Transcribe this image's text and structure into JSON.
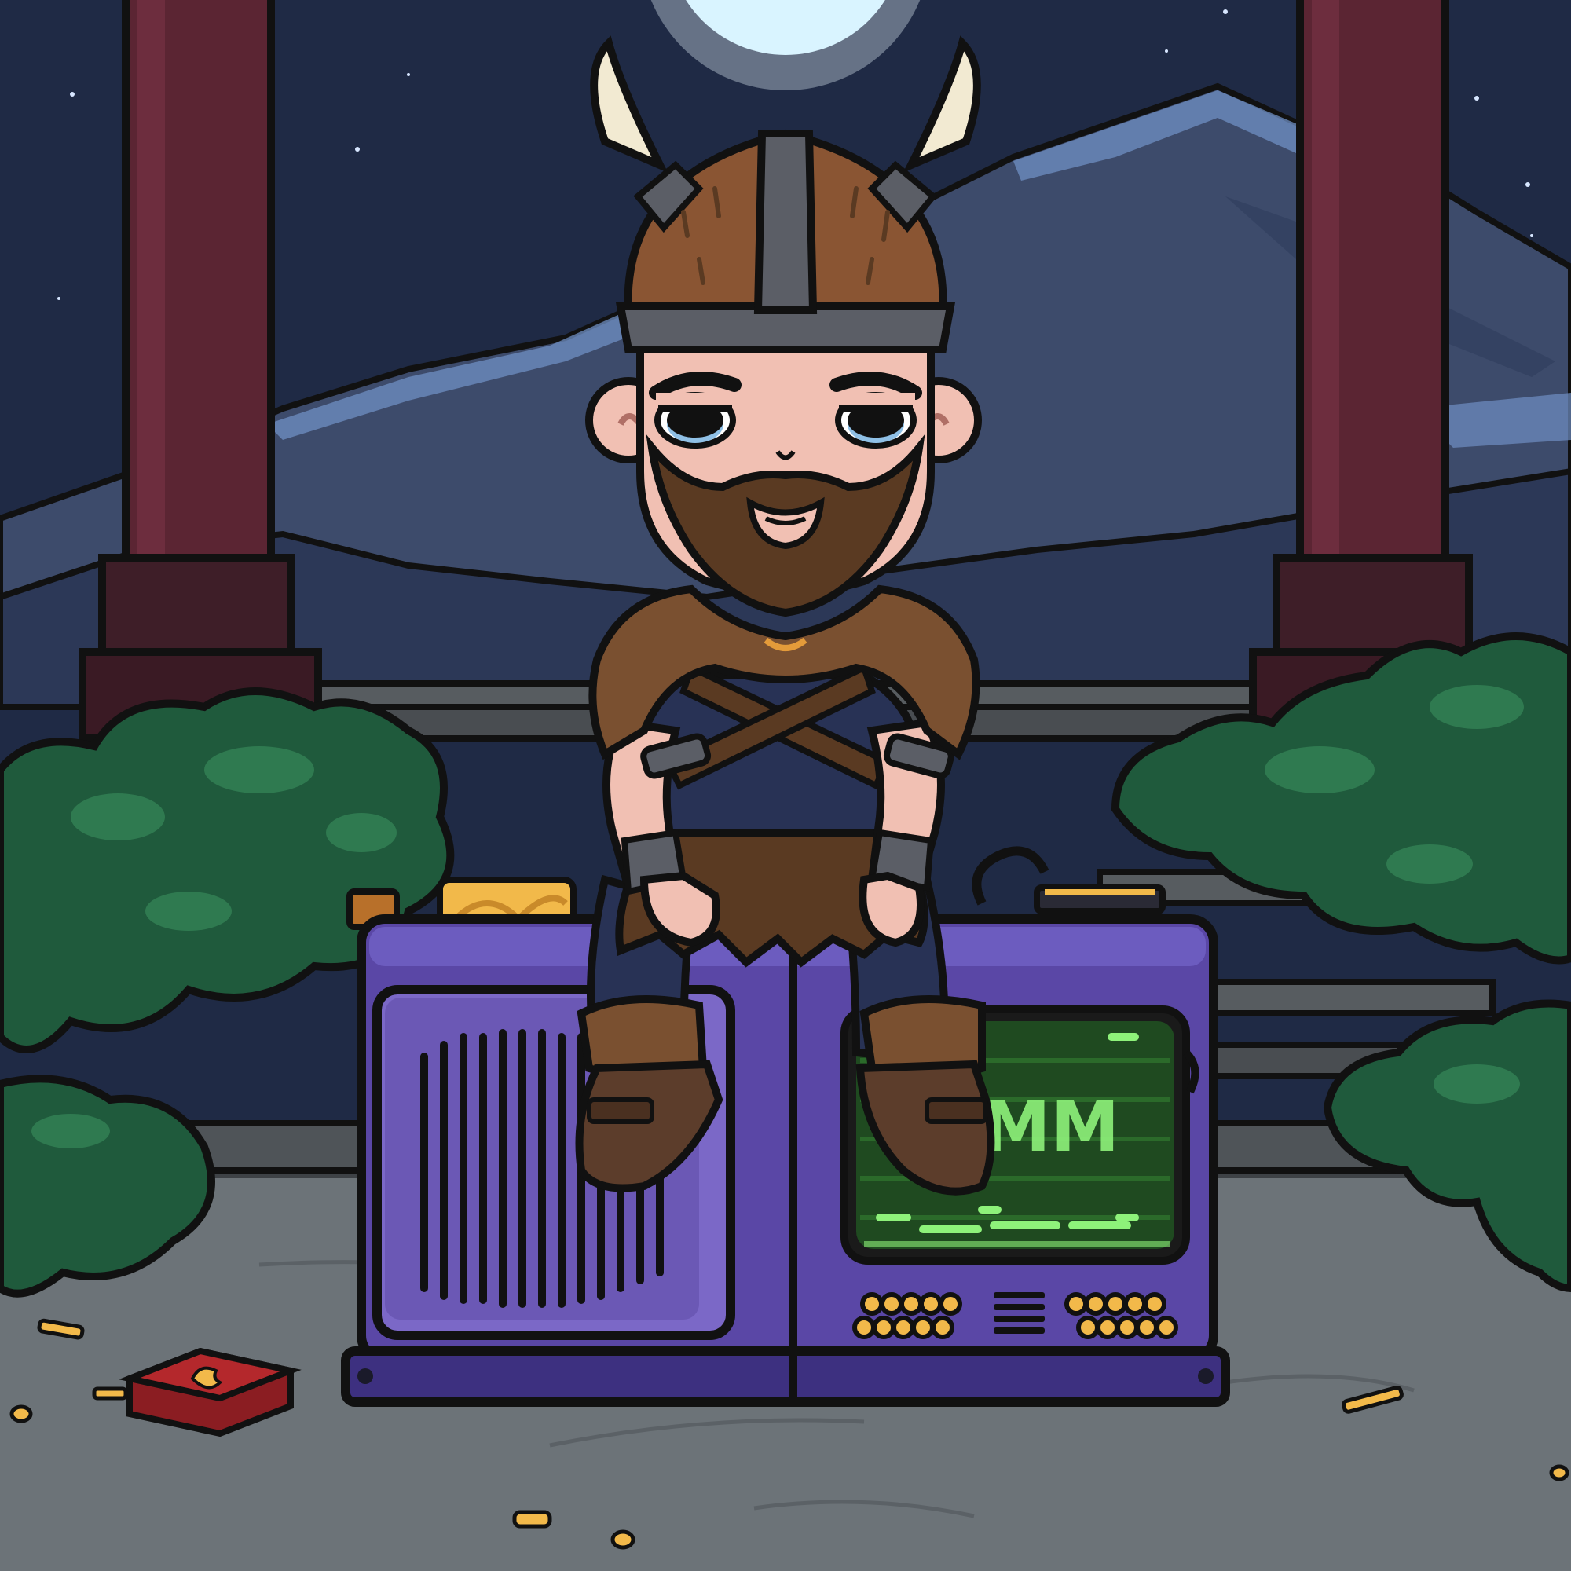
{
  "scene": {
    "type": "illustration",
    "subject": "viking-character-sitting-on-device"
  },
  "device": {
    "screen_text": "MM"
  },
  "matchbox": {
    "emblem": "flame-emblem"
  },
  "colors": {
    "sky": "#1f2a45",
    "moon": "#d9f4ff",
    "mountain": "#3d4b6b",
    "mountain_highlight": "#6f8fc3",
    "pillar": "#5b2533",
    "bush": "#1f5a3c",
    "bush_light": "#2f7a50",
    "ground": "#6c7378",
    "device_body": "#5a47a6",
    "device_panel": "#7b68c7",
    "screen_bg": "#1f4a20",
    "screen_glow": "#8ef27a",
    "helmet": "#8a5533",
    "helmet_band": "#5b5e66",
    "horn": "#f2ead2",
    "skin": "#f1c0b3",
    "beard": "#5a3a22",
    "fur": "#7a5030",
    "shirt": "#283255",
    "boots": "#5c3d2b",
    "outline": "#111111",
    "matchbox": "#b4282c",
    "gold": "#f2b94a"
  }
}
